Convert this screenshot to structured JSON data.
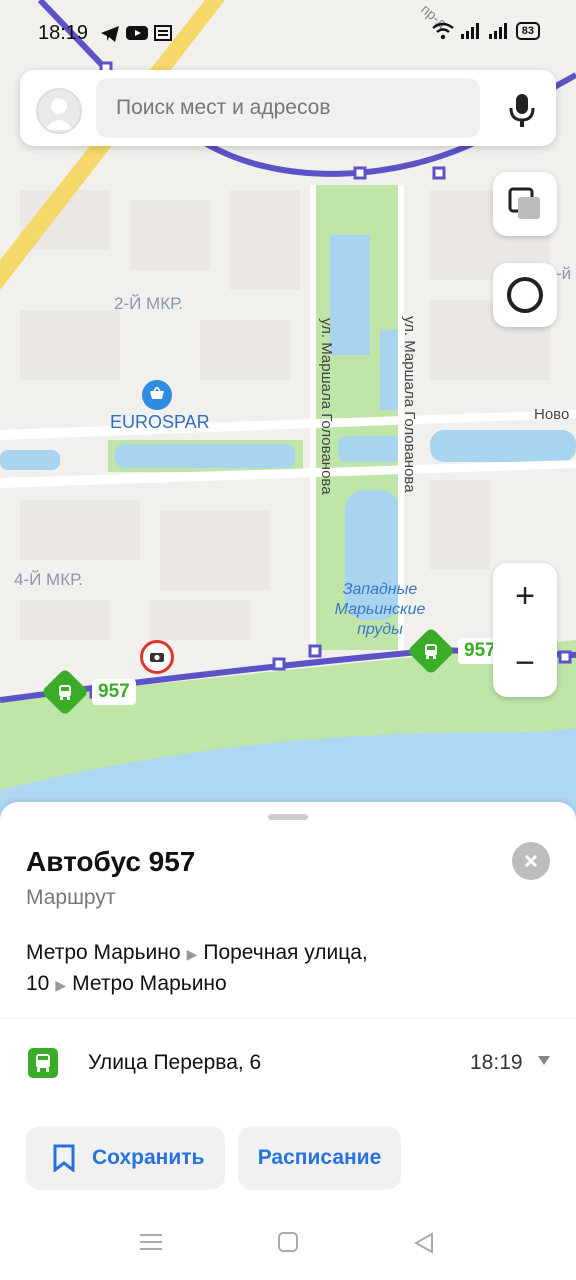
{
  "status_bar": {
    "time": "18:19",
    "battery": "83",
    "icons": [
      "telegram-icon",
      "youtube-icon",
      "news-icon",
      "wifi-icon",
      "signal-icon",
      "signal-icon-2",
      "battery-icon"
    ]
  },
  "search": {
    "placeholder": "Поиск мест и адресов"
  },
  "map": {
    "labels": {
      "district_2": "2-Й МКР.",
      "district_4": "4-Й МКР.",
      "eurospar": "EUROSPAR",
      "street_1": "ул. Маршала Голованова",
      "street_2": "ул. Маршала Голованова",
      "street_nov": "Ново",
      "ponds_line1": "Западные",
      "ponds_line2": "Марьинские",
      "ponds_line3": "пруды",
      "pr_d": "пр-д",
      "mkr_right": "-й"
    },
    "bus_badges": [
      "957",
      "957"
    ],
    "route_color": "#5b53c6",
    "zoom_in": "+",
    "zoom_out": "−"
  },
  "card": {
    "title": "Автобус 957",
    "subtitle": "Маршрут",
    "route_stops": [
      "Метро Марьино",
      "Поречная улица, 10",
      "Метро Марьино"
    ],
    "stop_name": "Улица Перерва, 6",
    "stop_time": "18:19",
    "save_label": "Сохранить",
    "schedule_label": "Расписание"
  },
  "colors": {
    "accent": "#2772de",
    "stop_green": "#3aac28",
    "route": "#5b53c6"
  }
}
